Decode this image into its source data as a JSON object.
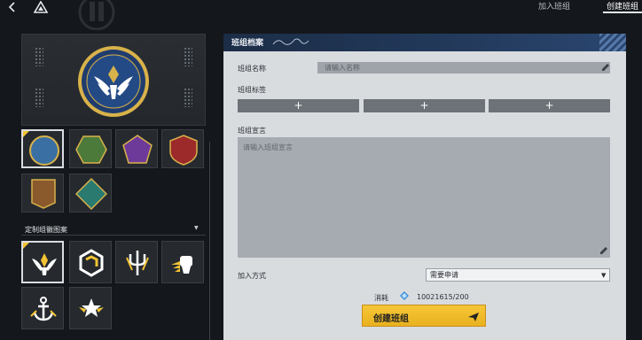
{
  "topbar": {
    "back_icon": "chevron-left-icon",
    "home_icon": "triangle-logo-icon",
    "tabs": [
      {
        "label": "加入班组",
        "active": false
      },
      {
        "label": "创建班组",
        "active": true
      }
    ]
  },
  "left": {
    "shape_swatches": [
      {
        "shape": "circle",
        "color": "#3a6fa3",
        "selected": true
      },
      {
        "shape": "hexagon",
        "color": "#4c7a3b",
        "selected": false
      },
      {
        "shape": "pentagon",
        "color": "#6e3a9a",
        "selected": false
      },
      {
        "shape": "shield",
        "color": "#9c2a2a",
        "selected": false
      },
      {
        "shape": "banner",
        "color": "#8a5a2d",
        "selected": false
      },
      {
        "shape": "diamond",
        "color": "#2a7a70",
        "selected": false
      }
    ],
    "custom_section_title": "定制组徽图案",
    "icon_tiles": [
      {
        "icon": "winged-shield-icon",
        "selected": true
      },
      {
        "icon": "hexagon-link-icon",
        "selected": false
      },
      {
        "icon": "trident-icon",
        "selected": false
      },
      {
        "icon": "winged-fist-icon",
        "selected": false
      },
      {
        "icon": "anchor-icon",
        "selected": false
      },
      {
        "icon": "winged-star-icon",
        "selected": false
      }
    ]
  },
  "panel": {
    "title": "班组档案",
    "name_label": "班组名称",
    "name_placeholder": "请输入名称",
    "tags_label": "班组标签",
    "tag_buttons": [
      "+",
      "+",
      "+"
    ],
    "motto_label": "班组宣言",
    "motto_placeholder": "请输入班组宣言",
    "join_label": "加入方式",
    "join_value": "需要申请",
    "cost_label": "消耗",
    "cost_value": "10021615/200",
    "create_label": "创建班组"
  },
  "colors": {
    "accent_yellow": "#f3c433",
    "panel_header_blue": "#233a5c"
  }
}
